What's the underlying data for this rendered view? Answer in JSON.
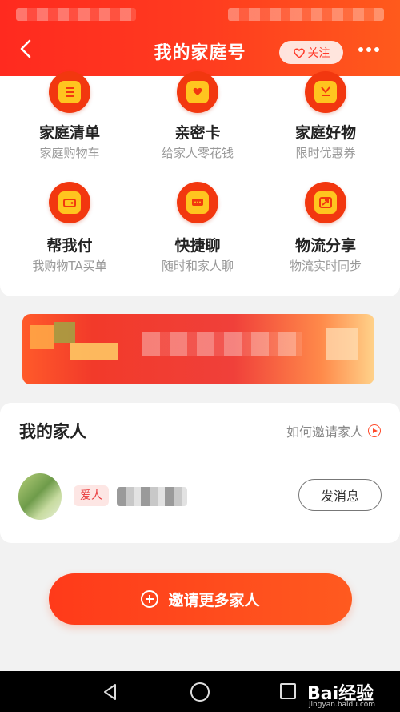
{
  "header": {
    "title": "我的家庭号",
    "follow_label": "关注",
    "icons": {
      "back": "chevron-left-icon",
      "follow": "heart-icon",
      "more": "more-dots-icon"
    }
  },
  "services": [
    {
      "label": "家庭清单",
      "sub": "家庭购物车",
      "icon": "list-icon"
    },
    {
      "label": "亲密卡",
      "sub": "给家人零花钱",
      "icon": "heart-card-icon"
    },
    {
      "label": "家庭好物",
      "sub": "限时优惠券",
      "icon": "shopping-bag-icon"
    },
    {
      "label": "帮我付",
      "sub": "我购物TA买单",
      "icon": "wallet-icon"
    },
    {
      "label": "快捷聊",
      "sub": "随时和家人聊",
      "icon": "chat-icon"
    },
    {
      "label": "物流分享",
      "sub": "物流实时同步",
      "icon": "share-icon"
    }
  ],
  "family": {
    "title": "我的家人",
    "how_invite": "如何邀请家人",
    "member": {
      "relation": "爱人",
      "message_button": "发消息"
    }
  },
  "invite_button": "邀请更多家人",
  "watermark": {
    "brand": "Bai经验",
    "url": "jingyan.baidu.com"
  },
  "colors": {
    "accent": "#ff3b1f",
    "icon_bg": "#f2370f",
    "icon_inner": "#ffc51f",
    "tag_text": "#e8383a"
  }
}
